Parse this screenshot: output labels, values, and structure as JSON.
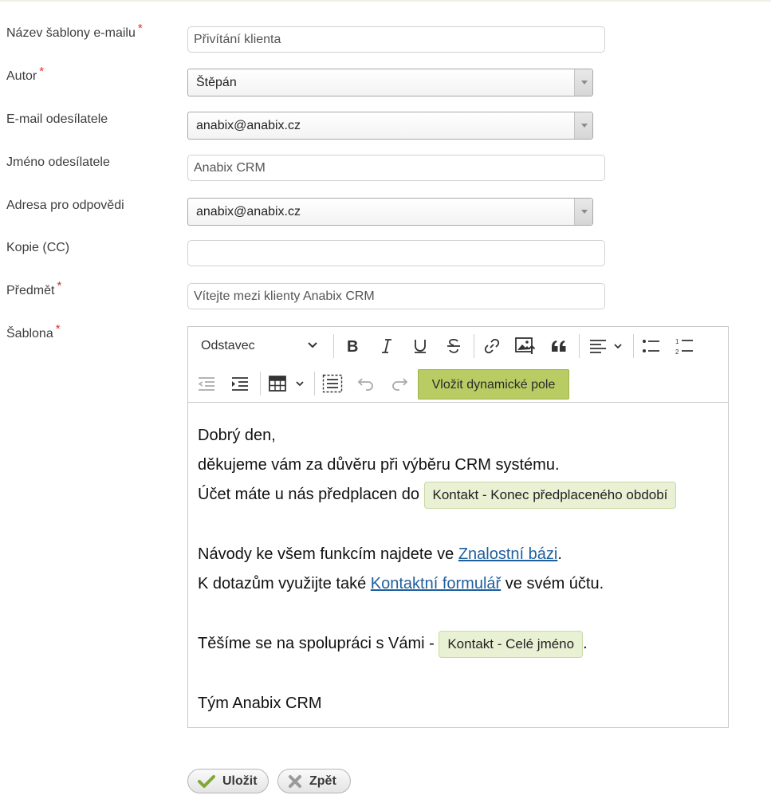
{
  "form": {
    "fields": [
      {
        "label": "Název šablony e-mailu",
        "required": true,
        "value": "Přivítání klienta"
      },
      {
        "label": "Autor",
        "required": true,
        "value": "Štěpán"
      },
      {
        "label": "E-mail odesílatele",
        "required": false,
        "value": "anabix@anabix.cz"
      },
      {
        "label": "Jméno odesílatele",
        "required": false,
        "value": "Anabix CRM"
      },
      {
        "label": "Adresa pro odpovědi",
        "required": false,
        "value": "anabix@anabix.cz"
      },
      {
        "label": "Kopie (CC)",
        "required": false,
        "value": ""
      },
      {
        "label": "Předmět",
        "required": true,
        "value": "Vítejte mezi klienty Anabix CRM"
      },
      {
        "label": "Šablona",
        "required": true
      }
    ],
    "required_mark": "*"
  },
  "editor": {
    "toolbar": {
      "heading_label": "Odstavec",
      "dynamic_field_button": "Vložit dynamické pole"
    },
    "content": {
      "greeting": "Dobrý den,",
      "thanks": "děkujeme vám za důvěru při výběru CRM systému.",
      "prepaid_text": "Účet máte u nás předplacen do",
      "prepaid_chip": "Kontakt - Konec předplaceného období",
      "guides_text": "Návody ke všem funkcím najdete ve",
      "guides_link": "Znalostní bázi",
      "guides_end": ".",
      "questions_text": "K dotazům využijte také",
      "questions_link": "Kontaktní formulář",
      "questions_end": "ve svém účtu.",
      "looking_text": "Těšíme se na spolupráci s Vámi -",
      "name_chip": "Kontakt - Celé jméno",
      "looking_end": ".",
      "signature": "Tým Anabix CRM"
    }
  },
  "actions": {
    "save_label": "Uložit",
    "back_label": "Zpět"
  },
  "colors": {
    "accent_button": "#b8cc63",
    "chip_background": "#e9f1d4",
    "link": "#1f5f9c",
    "required": "#e03030"
  }
}
